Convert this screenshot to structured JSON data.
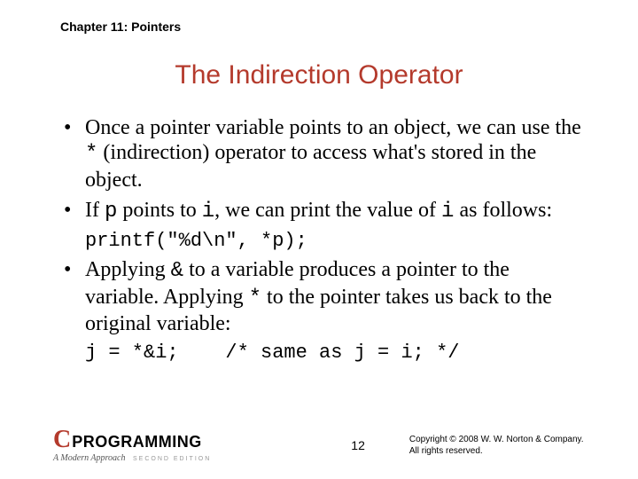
{
  "chapter": "Chapter 11: Pointers",
  "title": "The Indirection Operator",
  "bullets": [
    {
      "pre": "Once a pointer variable points to an object, we can use the ",
      "code1": "*",
      "post": " (indirection) operator to access what's stored in the object."
    },
    {
      "pre": "If ",
      "code1": "p",
      "mid1": " points to ",
      "code2": "i",
      "mid2": ", we can print the value of ",
      "code3": "i",
      "post": " as follows:"
    }
  ],
  "codeline1": "printf(\"%d\\n\", *p);",
  "bullets2": [
    {
      "pre": "Applying ",
      "code1": "&",
      "mid1": " to a variable produces a pointer to the variable. Applying ",
      "code2": "*",
      "post": " to the pointer takes us back to the original variable:"
    }
  ],
  "codeline2": "j = *&i;    /* same as j = i; */",
  "logo": {
    "c": "C",
    "rest": "PROGRAMMING",
    "sub": "A Modern Approach",
    "ed": "SECOND EDITION"
  },
  "page": "12",
  "copyright1": "Copyright © 2008 W. W. Norton & Company.",
  "copyright2": "All rights reserved."
}
